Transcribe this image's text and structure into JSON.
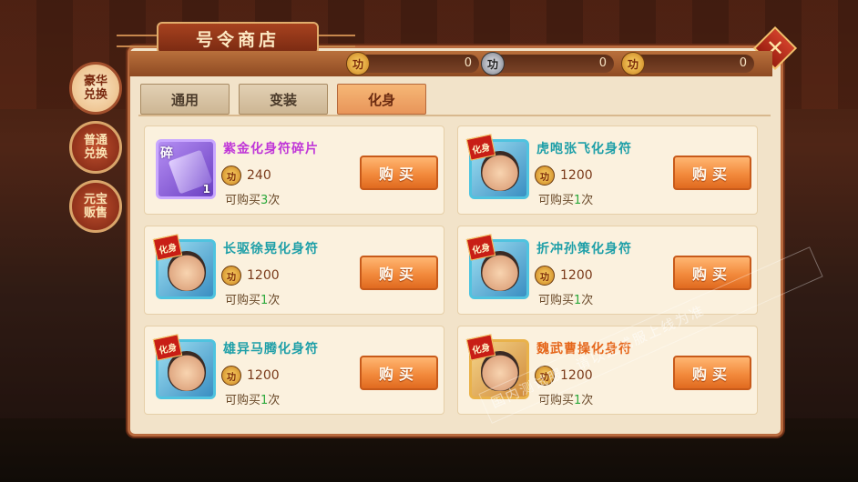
{
  "window": {
    "title": "号令商店",
    "close_icon": "close-icon"
  },
  "colors": {
    "accent": "#f28a3c",
    "panel": "#f2e3c9",
    "purple_name": "#c037d8",
    "teal_name": "#1e9fa8",
    "orange_name": "#e5661a",
    "limit_count": "#2aa83a"
  },
  "side_tabs": [
    {
      "label": "豪华兑换",
      "active": true
    },
    {
      "label": "普通兑换",
      "active": false
    },
    {
      "label": "元宝贩售",
      "active": false
    }
  ],
  "currencies": [
    {
      "icon": "merit-coin-icon",
      "glyph": "功",
      "value": "0"
    },
    {
      "icon": "merit-silver-coin-icon",
      "glyph": "功",
      "value": "0"
    },
    {
      "icon": "merit-coin-icon",
      "glyph": "功",
      "value": "0"
    }
  ],
  "tabs": [
    {
      "label": "通用",
      "active": false
    },
    {
      "label": "变装",
      "active": false
    },
    {
      "label": "化身",
      "active": true
    }
  ],
  "items": [
    {
      "name": "紫金化身符碎片",
      "price": "240",
      "limit_prefix": "可购买",
      "limit_count": "3",
      "limit_suffix": "次",
      "buy": "购买",
      "icon_tag": "碎",
      "icon_count": "1",
      "name_color": "purple"
    },
    {
      "name": "虎咆张飞化身符",
      "price": "1200",
      "limit_prefix": "可购买",
      "limit_count": "1",
      "limit_suffix": "次",
      "buy": "购买",
      "icon_tag": "化身",
      "name_color": "teal"
    },
    {
      "name": "长驱徐晃化身符",
      "price": "1200",
      "limit_prefix": "可购买",
      "limit_count": "1",
      "limit_suffix": "次",
      "buy": "购买",
      "icon_tag": "化身",
      "name_color": "teal"
    },
    {
      "name": "折冲孙策化身符",
      "price": "1200",
      "limit_prefix": "可购买",
      "limit_count": "1",
      "limit_suffix": "次",
      "buy": "购买",
      "icon_tag": "化身",
      "name_color": "teal"
    },
    {
      "name": "雄异马腾化身符",
      "price": "1200",
      "limit_prefix": "可购买",
      "limit_count": "1",
      "limit_suffix": "次",
      "buy": "购买",
      "icon_tag": "化身",
      "name_color": "teal"
    },
    {
      "name": "魏武曹操化身符",
      "price": "1200",
      "limit_prefix": "可购买",
      "limit_count": "1",
      "limit_suffix": "次",
      "buy": "购买",
      "icon_tag": "化身",
      "name_color": "orange"
    }
  ],
  "price_coin_glyph": "功",
  "watermark": "国内测试服，请以正式服上线为准"
}
